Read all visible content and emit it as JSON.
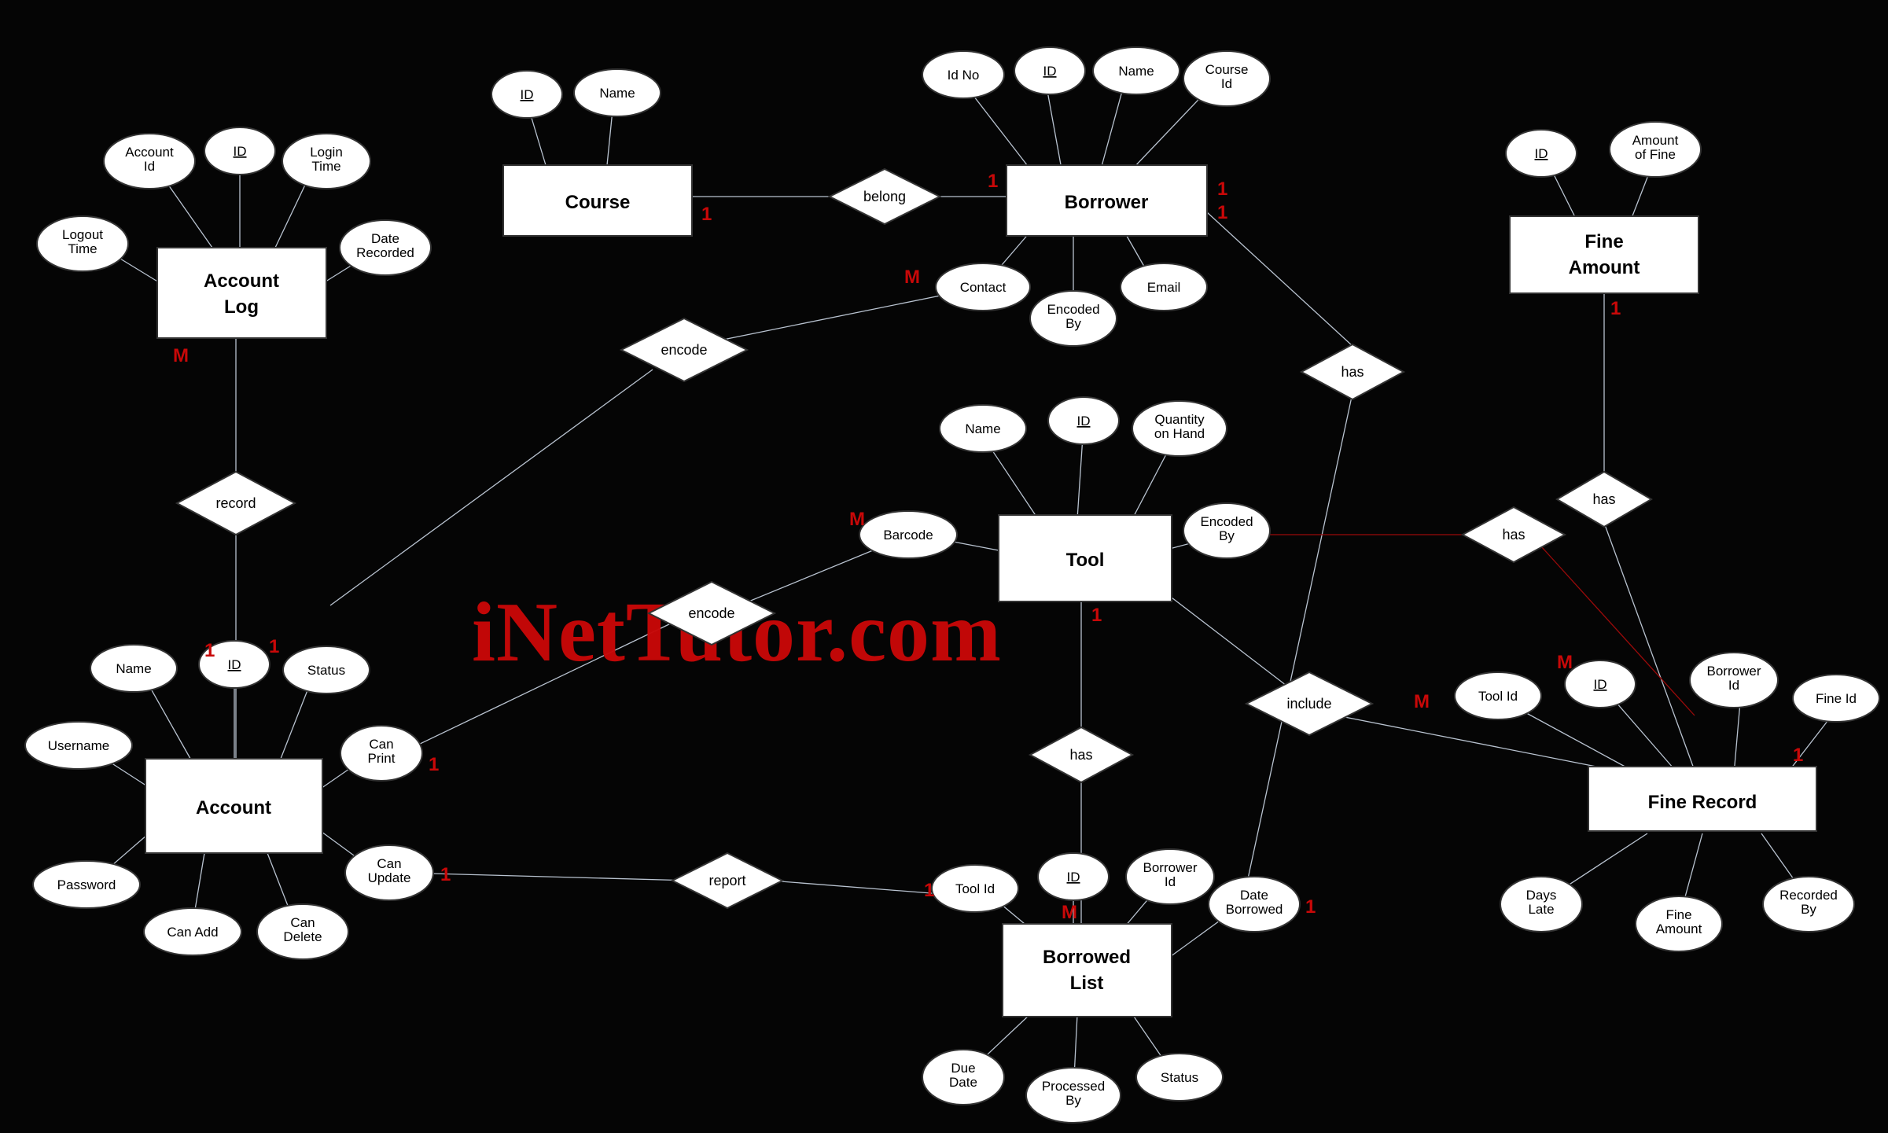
{
  "watermark": "iNetTutor.com",
  "entities": {
    "course": "Course",
    "borrower": "Borrower",
    "fineAmount": "Fine\nAmount",
    "accountLog": "Account\nLog",
    "tool": "Tool",
    "account": "Account",
    "borrowedList": "Borrowed\nList",
    "fineRecord": "Fine Record"
  },
  "attributes": {
    "course": {
      "id": "ID",
      "name": "Name"
    },
    "borrower": {
      "idNo": "Id No",
      "id": "ID",
      "name": "Name",
      "courseId": "Course\nId",
      "contact": "Contact",
      "encodedBy": "Encoded\nBy",
      "email": "Email"
    },
    "fineAmount": {
      "id": "ID",
      "amount": "Amount\nof Fine"
    },
    "accountLog": {
      "accountId": "Account\nId",
      "id": "ID",
      "loginTime": "Login\nTime",
      "logoutTime": "Logout\nTime",
      "dateRecorded": "Date\nRecorded"
    },
    "tool": {
      "name": "Name",
      "id": "ID",
      "qty": "Quantity\non Hand",
      "barcode": "Barcode",
      "encodedBy": "Encoded\nBy"
    },
    "account": {
      "name": "Name",
      "id": "ID",
      "status": "Status",
      "username": "Username",
      "canPrint": "Can\nPrint",
      "password": "Password",
      "canUpdate": "Can\nUpdate",
      "canAdd": "Can Add",
      "canDelete": "Can\nDelete"
    },
    "borrowedList": {
      "toolId": "Tool Id",
      "id": "ID",
      "borrowerId": "Borrower\nId",
      "dateBorrowed": "Date\nBorrowed",
      "dueDate": "Due\nDate",
      "processedBy": "Processed\nBy",
      "status": "Status"
    },
    "fineRecord": {
      "toolId": "Tool Id",
      "id": "ID",
      "borrowerId": "Borrower\nId",
      "fineId": "Fine Id",
      "daysLate": "Days\nLate",
      "fineAmt": "Fine\nAmount",
      "recordedBy": "Recorded\nBy"
    }
  },
  "relationships": {
    "belong": "belong",
    "encode1": "encode",
    "has_borrower": "has",
    "has_fine": "has",
    "has_fine2": "has",
    "record": "record",
    "encode2": "encode",
    "include": "include",
    "has_tool": "has",
    "report": "report"
  },
  "cardinalities": {
    "one": "1",
    "many": "M"
  }
}
